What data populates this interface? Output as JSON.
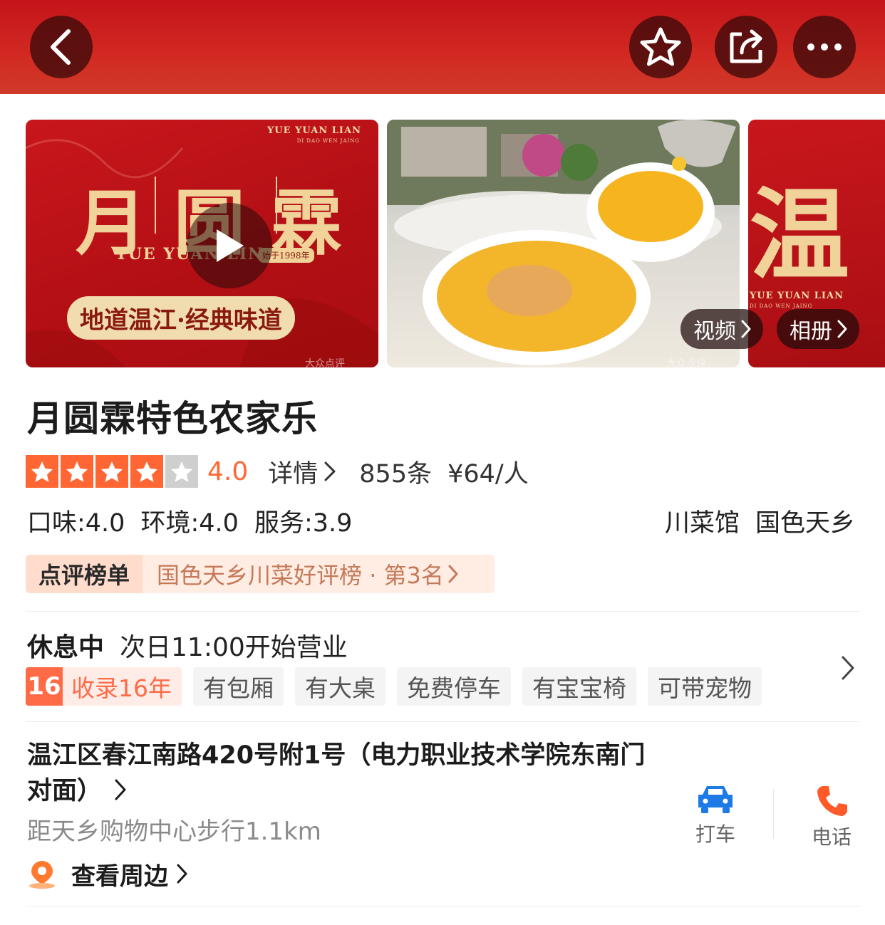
{
  "colors": {
    "header_red": "#c4141a",
    "rating_orange": "#ff6633",
    "rank_text": "#c47a5a",
    "car_blue": "#1e7be6",
    "phone_orange": "#ff5a2a"
  },
  "header": {
    "back_icon": "chevron-left-icon",
    "favorite_icon": "star-outline-icon",
    "share_icon": "share-icon",
    "more_icon": "more-horizontal-icon"
  },
  "gallery": {
    "tile1": {
      "brand_en": "YUE YUAN LIAN",
      "brand_sub": "DI DAO WEN JAING",
      "chars": [
        "月",
        "圆",
        "霖"
      ],
      "logo_line": "YUE YUAN LIN",
      "since": "始于1998年",
      "slogan": "地道温江·经典味道",
      "watermark": "大众点评",
      "play_icon": "play-icon"
    },
    "tile2": {
      "watermark": "大众点评",
      "video_label": "视频"
    },
    "tile3": {
      "chars": "温",
      "brand_en": "YUE YUAN LIAN",
      "brand_sub": "DI DAO WEN JAING",
      "album_label": "相册"
    }
  },
  "shop": {
    "title": "月圆霖特色农家乐",
    "rating": 4.0,
    "rating_text": "4.0",
    "stars_filled": 4,
    "stars_total": 5,
    "detail_label": "详情",
    "review_count": "855条",
    "price": "¥64/人",
    "scores": [
      "口味:4.0",
      "环境:4.0",
      "服务:3.9"
    ],
    "tags": [
      "川菜馆",
      "国色天乡"
    ]
  },
  "rank": {
    "label_left": "点评",
    "label_right": "榜单",
    "text": "国色天乡川菜好评榜 · 第3名"
  },
  "hours": {
    "status": "休息中",
    "next": "次日11:00开始营业"
  },
  "features": {
    "years_num": "16",
    "years_text": "收录16年",
    "items": [
      "有包厢",
      "有大桌",
      "免费停车",
      "有宝宝椅",
      "可带宠物"
    ]
  },
  "location": {
    "address": "温江区春江南路420号附1号（电力职业技术学院东南门对面）",
    "distance": "距天乡购物中心步行1.1km",
    "nearby_label": "查看周边",
    "nearby_icon": "location-pin-icon"
  },
  "actions": {
    "taxi_label": "打车",
    "taxi_icon": "car-icon",
    "phone_label": "电话",
    "phone_icon": "phone-icon"
  }
}
